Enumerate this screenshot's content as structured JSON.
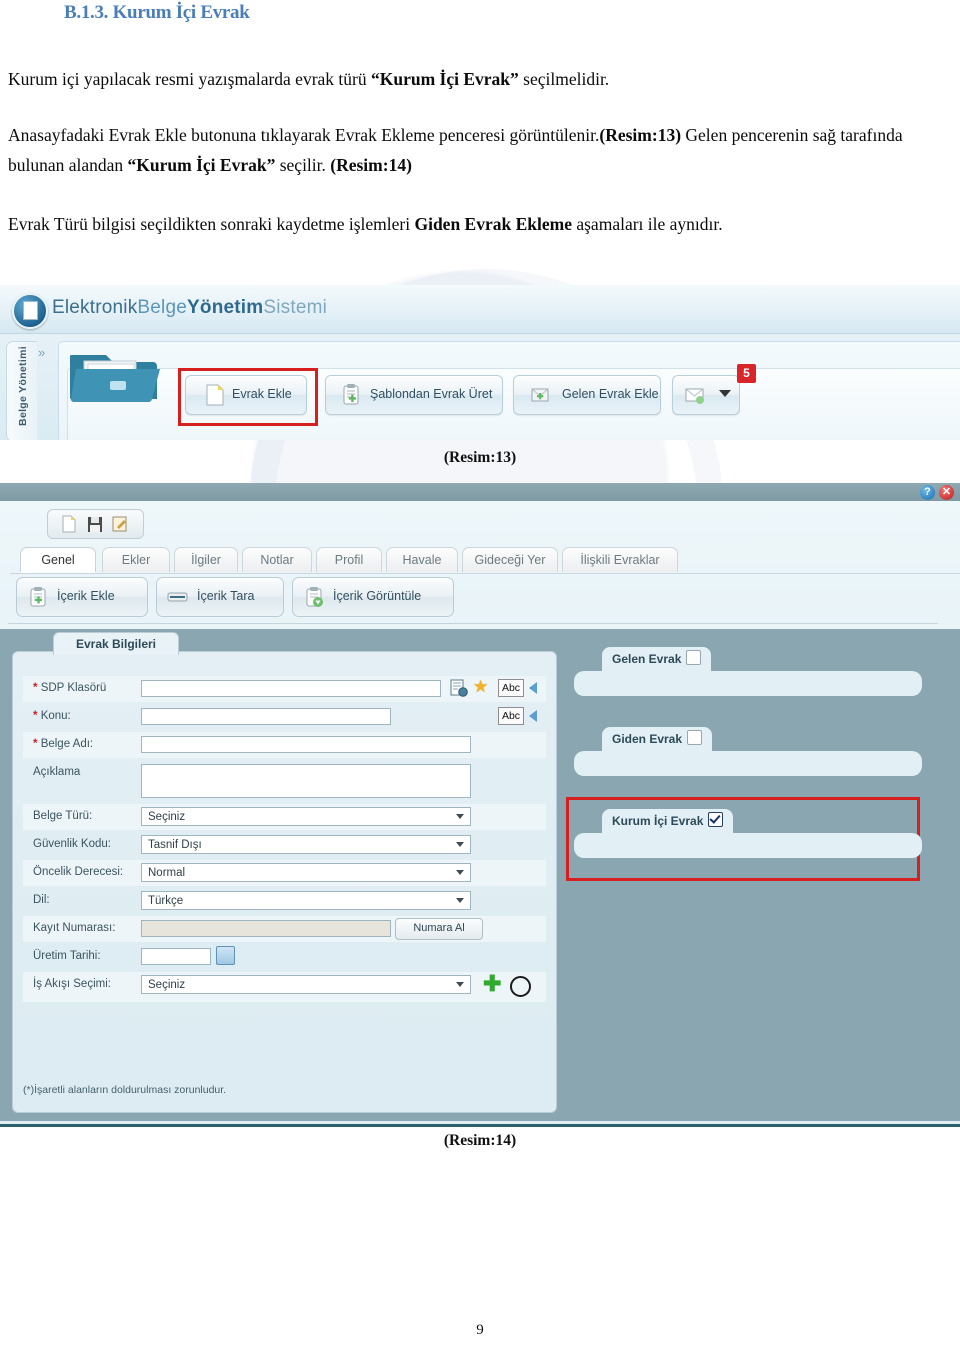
{
  "document": {
    "title": "B.1.3. Kurum İçi Evrak",
    "title_color": "#4a7ebb",
    "page_number": "9",
    "paragraphs": {
      "p1_a": "Kurum içi yapılacak resmi yazışmalarda evrak türü ",
      "p1_b": "“Kurum İçi Evrak”",
      "p1_c": " seçilmelidir.",
      "p2_a": "Anasayfadaki Evrak Ekle butonuna tıklayarak Evrak Ekleme penceresi görüntülenir.",
      "p2_b": "(Resim:13)",
      "p2_c": " Gelen pencerenin sağ tarafında bulunan alandan ",
      "p2_d": "“Kurum İçi Evrak”",
      "p2_e": "  seçilir. ",
      "p2_f": "(Resim:14)",
      "p3_a": "Evrak Türü bilgisi seçildikten sonraki kaydetme işlemleri ",
      "p3_b": "Giden Evrak Ekleme",
      "p3_c": " aşamaları ile aynıdır."
    },
    "captions": {
      "resim13": "(Resim:13)",
      "resim14": "(Resim:14)"
    }
  },
  "screenshot1": {
    "app_title_parts": {
      "part1": "Elektronik",
      "part2": "Belge",
      "part3": "Yönetim",
      "part4": "Sistemi"
    },
    "logo_icon": "document-logo-icon",
    "side_tab_label": "Belge Yönetimi",
    "expand_icon": "»",
    "toolbar_buttons": [
      {
        "label": "Evrak Ekle",
        "icon": "new-document-icon",
        "highlighted": true
      },
      {
        "label": "Şablondan Evrak Üret",
        "icon": "template-document-icon",
        "highlighted": false
      },
      {
        "label": "Gelen Evrak Ekle",
        "icon": "incoming-envelope-icon",
        "highlighted": false
      }
    ],
    "mail_button": {
      "icon": "mail-add-icon",
      "dropdown_icon": "caret-down-icon",
      "badge_count": "5"
    },
    "highlight_color": "#d61f1f"
  },
  "screenshot2": {
    "titlebar": {
      "help_icon": "?",
      "close_icon": "✕"
    },
    "mini_toolbar": [
      {
        "icon": "new-document-icon"
      },
      {
        "icon": "save-floppy-icon"
      },
      {
        "icon": "edit-pencil-icon"
      }
    ],
    "tabs": [
      {
        "label": "Genel",
        "active": true
      },
      {
        "label": "Ekler",
        "active": false
      },
      {
        "label": "İlgiler",
        "active": false
      },
      {
        "label": "Notlar",
        "active": false
      },
      {
        "label": "Profil",
        "active": false
      },
      {
        "label": "Havale",
        "active": false
      },
      {
        "label": "Gideceği Yer",
        "active": false
      },
      {
        "label": "İlişkili Evraklar",
        "active": false
      }
    ],
    "content_buttons": [
      {
        "label": "İçerik Ekle",
        "icon": "clipboard-add-icon"
      },
      {
        "label": "İçerik Tara",
        "icon": "scanner-icon"
      },
      {
        "label": "İçerik Görüntüle",
        "icon": "clipboard-view-icon"
      }
    ],
    "left_panel": {
      "tab_label": "Evrak Bilgileri",
      "fields": [
        {
          "label": "SDP Klasörü",
          "required": true,
          "type": "text",
          "value": ""
        },
        {
          "label": "Konu:",
          "required": true,
          "type": "text",
          "value": ""
        },
        {
          "label": "Belge Adı:",
          "required": true,
          "type": "text",
          "value": ""
        },
        {
          "label": "Açıklama",
          "required": false,
          "type": "textarea",
          "value": ""
        },
        {
          "label": "Belge Türü:",
          "required": false,
          "type": "select",
          "value": "Seçiniz"
        },
        {
          "label": "Güvenlik Kodu:",
          "required": false,
          "type": "select",
          "value": "Tasnif Dışı"
        },
        {
          "label": "Öncelik Derecesi:",
          "required": false,
          "type": "select",
          "value": "Normal"
        },
        {
          "label": "Dil:",
          "required": false,
          "type": "select",
          "value": "Türkçe"
        },
        {
          "label": "Kayıt Numarası:",
          "required": false,
          "type": "text-readonly",
          "value": ""
        },
        {
          "label": "Üretim Tarihi:",
          "required": false,
          "type": "date",
          "value": ""
        },
        {
          "label": "İş Akışı Seçimi:",
          "required": false,
          "type": "select",
          "value": "Seçiniz"
        }
      ],
      "abc_button_label": "Abc",
      "numara_al_label": "Numara Al",
      "footer_note": "(*)İşaretli alanların doldurulması zorunludur."
    },
    "right_panel": {
      "groups": [
        {
          "label": "Gelen Evrak",
          "checked": false,
          "highlighted": false
        },
        {
          "label": "Giden Evrak",
          "checked": false,
          "highlighted": false
        },
        {
          "label": "Kurum İçi Evrak",
          "checked": true,
          "highlighted": true
        }
      ]
    },
    "highlight_color": "#d61f1f"
  }
}
